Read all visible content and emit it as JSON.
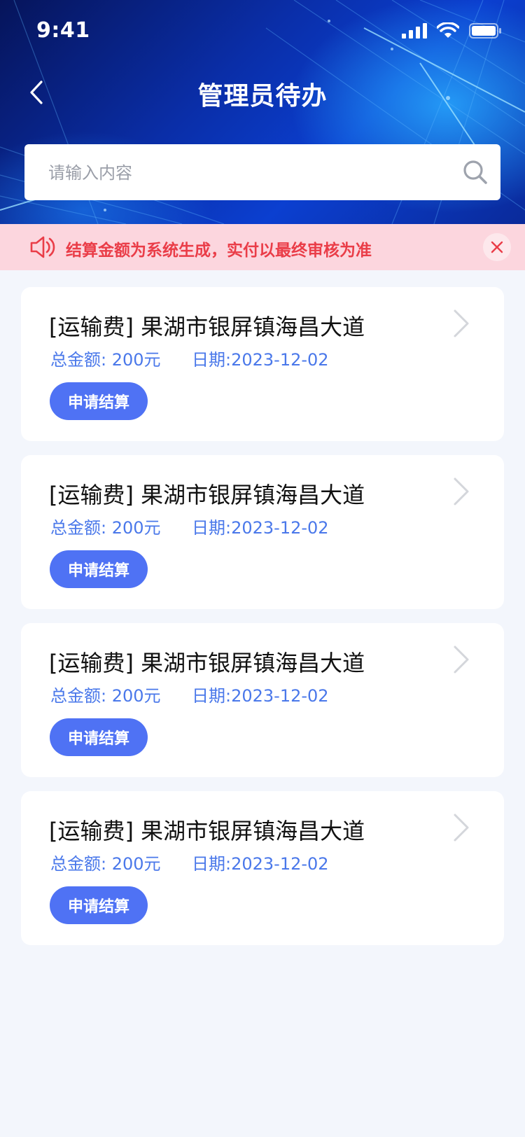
{
  "status_bar": {
    "time": "9:41"
  },
  "header": {
    "title": "管理员待办"
  },
  "search": {
    "placeholder": "请输入内容",
    "value": ""
  },
  "notice": {
    "text": "结算金额为系统生成，实付以最终审核为准"
  },
  "items": [
    {
      "title": "[运输费] 果湖市银屏镇海昌大道",
      "amount": "总金额: 200元",
      "date": "日期:2023-12-02",
      "action": "申请结算"
    },
    {
      "title": "[运输费] 果湖市银屏镇海昌大道",
      "amount": "总金额: 200元",
      "date": "日期:2023-12-02",
      "action": "申请结算"
    },
    {
      "title": "[运输费] 果湖市银屏镇海昌大道",
      "amount": "总金额: 200元",
      "date": "日期:2023-12-02",
      "action": "申请结算"
    },
    {
      "title": "[运输费] 果湖市银屏镇海昌大道",
      "amount": "总金额: 200元",
      "date": "日期:2023-12-02",
      "action": "申请结算"
    }
  ],
  "icons": {
    "back": "chevron-left-icon",
    "search": "search-icon",
    "notice": "speaker-icon",
    "close": "close-icon",
    "item_arrow": "chevron-right-icon",
    "signal": "cellular-signal-icon",
    "wifi": "wifi-icon",
    "battery": "battery-icon"
  },
  "colors": {
    "header_bg": "#0b3fd0",
    "notice_bg": "#fcd6de",
    "notice_text": "#ea3d48",
    "meta_text": "#4a78ea",
    "button_bg": "#4f72f4",
    "page_bg": "#f3f6fc"
  }
}
